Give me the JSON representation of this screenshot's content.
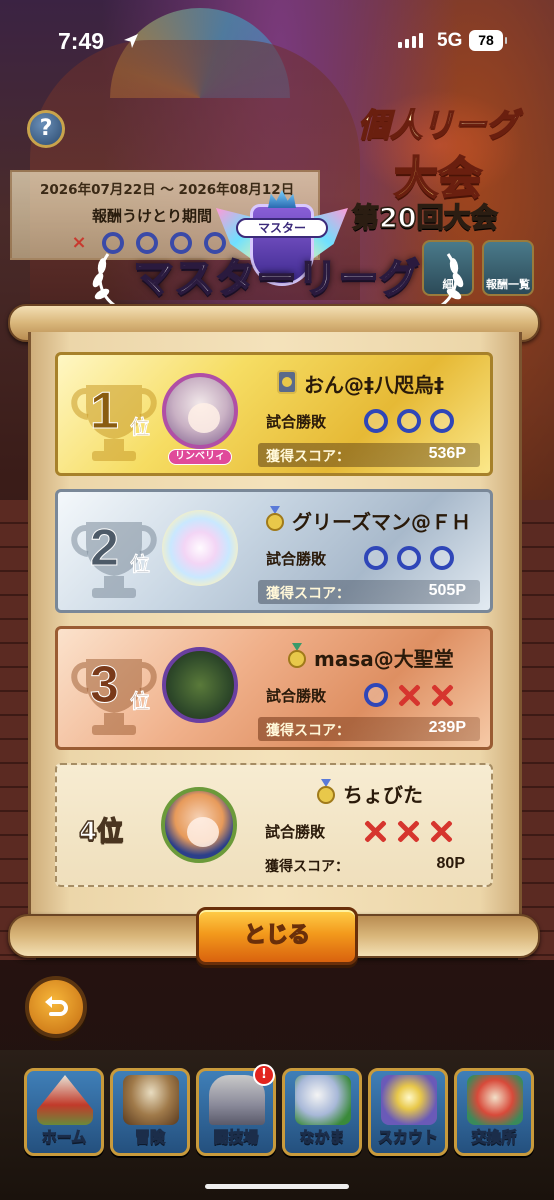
{
  "status_bar": {
    "time": "7:49",
    "network": "5G",
    "battery": "78"
  },
  "event": {
    "title_line1": "個人リーグ",
    "title_line2": "大会",
    "edition": "第20回大会"
  },
  "period": {
    "dates": "2026年07月22日 ～ 2026年08月12日",
    "label": "報酬うけとり期間",
    "marks": [
      "×",
      "○",
      "○",
      "○",
      "○"
    ]
  },
  "side_buttons": [
    "細",
    "報酬一覧"
  ],
  "league": {
    "emblem_tag": "マスター",
    "title": "マスターリーグ"
  },
  "labels": {
    "result": "試合勝敗",
    "score": "獲得スコア："
  },
  "rankings": [
    {
      "rank": "1",
      "suffix": "位",
      "name": "おん@‡八咫烏‡",
      "badge": "リンベリィ",
      "results": [
        "win",
        "win",
        "win"
      ],
      "score": "536P"
    },
    {
      "rank": "2",
      "suffix": "位",
      "name": "グリーズマン@ＦＨ",
      "results": [
        "win",
        "win",
        "win"
      ],
      "score": "505P"
    },
    {
      "rank": "3",
      "suffix": "位",
      "name": "masa@大聖堂",
      "results": [
        "win",
        "loss",
        "loss"
      ],
      "score": "239P"
    },
    {
      "rank": "4位",
      "name": "ちょびた",
      "results": [
        "loss",
        "loss",
        "loss"
      ],
      "score": "80P"
    }
  ],
  "close_button": "とじる",
  "nav": [
    {
      "label": "ホーム",
      "icon": "home-tent-icon"
    },
    {
      "label": "冒険",
      "icon": "adventure-wagon-icon"
    },
    {
      "label": "闘技場",
      "icon": "arena-icon",
      "notify": "!"
    },
    {
      "label": "なかま",
      "icon": "companions-icon"
    },
    {
      "label": "スカウト",
      "icon": "scout-icon"
    },
    {
      "label": "交換所",
      "icon": "exchange-icon"
    }
  ],
  "colors": {
    "gold": "#f6dd63",
    "silver": "#c8d6e3",
    "bronze": "#f0b08a",
    "win": "#2f46b8",
    "loss": "#d6352e",
    "button": "#f39a1c"
  }
}
